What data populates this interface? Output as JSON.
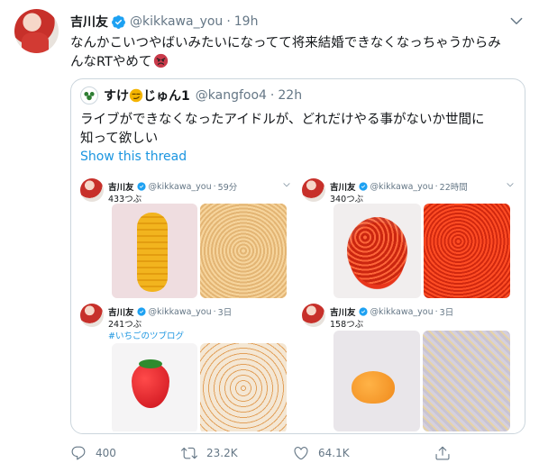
{
  "tweet": {
    "author_name": "吉川友",
    "handle": "@kikkawa_you",
    "separator": "·",
    "time": "19h",
    "text_line1": "なんかこいつやばいみたいになってて将来結婚できなくなっちゃうからみ",
    "text_line2": "んなRTやめて"
  },
  "quote": {
    "author_name_a": "すけ",
    "author_name_b": "じゅん1",
    "handle": "@kangfoo4",
    "separator": "·",
    "time": "22h",
    "text_line1": "ライブができなくなったアイドルが、どれだけやる事がないか世間に",
    "text_line2": "知って欲しい",
    "show_thread": "Show this thread"
  },
  "mini_posts": [
    {
      "name": "吉川友",
      "handle": "@kikkawa_you",
      "separator": "·",
      "time": "59分",
      "count": "433つぶ"
    },
    {
      "name": "",
      "handle": "@kikkawa_you",
      "separator": "·",
      "time": "22時間",
      "count": "340つぶ"
    },
    {
      "name": "吉川友",
      "handle": "@kikkawa_you",
      "separator": "·",
      "time": "3日",
      "count": "241つぶ",
      "tag": "#いちごのツブログ"
    },
    {
      "name": "吉川友",
      "handle": "@kikkawa_you",
      "separator": "·",
      "time": "3日",
      "count": "158つぶ"
    }
  ],
  "actions": {
    "reply_count": "400",
    "retweet_count": "23.2K",
    "like_count": "64.1K"
  },
  "colors": {
    "link": "#1b95e0",
    "verified": "#1da1f2",
    "secondary_text": "#657786",
    "border": "#ccd6dd"
  },
  "icons": [
    "verified-badge-icon",
    "chevron-down-icon",
    "angry-face-emoji-icon",
    "reply-icon",
    "retweet-icon",
    "like-icon",
    "share-icon"
  ]
}
